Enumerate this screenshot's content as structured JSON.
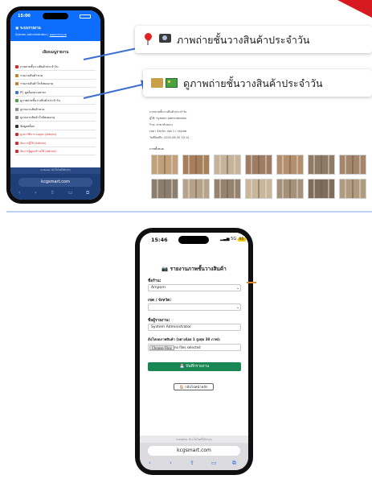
{
  "phone1": {
    "time": "15:00",
    "brand": "ระบบรายงาน",
    "user_prefix": "System Administrator |",
    "logout": "ออกจากระบบ",
    "menu_title": "เลือกเมนูรายงาน",
    "menu_items": [
      {
        "label": "ภาพถ่ายชั้นวางสินค้าประจำวัน",
        "icon": "pin-camera-icon",
        "color": "#e02424",
        "red": false
      },
      {
        "label": "รายงานสินค้าขาด",
        "icon": "box-icon",
        "color": "#c9802e",
        "red": false
      },
      {
        "label": "รายงานสินค้าใกล้หมดอายุ",
        "icon": "box-icon",
        "color": "#c9802e",
        "red": false
      },
      {
        "label": "PC ดูสต็อกตามสาขา",
        "icon": "pc-icon",
        "color": "#3b77d6",
        "red": false
      },
      {
        "label": "ดูภาพถ่ายชั้นวางสินค้าประจำวัน",
        "icon": "folder-picture-icon",
        "color": "#48a23f",
        "red": false
      },
      {
        "label": "ดูรายงานสินค้าขาด",
        "icon": "clipboard-icon",
        "color": "#8a8a8a",
        "red": false
      },
      {
        "label": "ดูรายงานสินค้าใกล้หมดอายุ",
        "icon": "clipboard-icon",
        "color": "#8a8a8a",
        "red": false
      },
      {
        "label": "ข้อมูลสต็อก",
        "icon": "chat-icon",
        "color": "#333333",
        "red": false
      },
      {
        "label": "ดูประวัติการ Login (Admin)",
        "icon": "user-icon",
        "color": "#d72a2a",
        "red": true
      },
      {
        "label": "จัดการผู้ใช้ (Admin)",
        "icon": "user-icon",
        "color": "#d72a2a",
        "red": true
      },
      {
        "label": "จัดการผู้ดูแลร้านใช้ (Admin)",
        "icon": "user-icon",
        "color": "#d72a2a",
        "red": true
      }
    ],
    "footer": "Installer นำเว็บไซต์ได้ง่ายๆ",
    "url": "kcgsmart.com"
  },
  "callouts": {
    "take_photo": "ภาพถ่ายชั้นวางสินค้าประจำวัน",
    "view_photo": "ดูภาพถ่ายชั้นวางสินค้าประจำวัน"
  },
  "report": {
    "lines": [
      "ภาพถ่ายชั้นวางสินค้าประจำวัน",
      "ผู้ใช้: System Administrator",
      "ร้าน: สาขาตัวอย่าง",
      "เขต / จังหวัด: เขต 1 / กรุงเทพ",
      "วันที่บันทึก: 2025-06-30 10:12"
    ],
    "gallery_label": "ภาพทั้งหมด",
    "thumb_colors": [
      [
        "#c2a079",
        "#a87f5b",
        "#c6b39a",
        "#9e7d63",
        "#b48f6d",
        "#8f7a66",
        "#a4866c"
      ],
      [
        "#8c7d6f",
        "#b7a38b",
        "#95826f",
        "#c9b79c",
        "#a59079",
        "#7f6c5b",
        "#b09a80"
      ]
    ]
  },
  "phone2": {
    "time": "15:46",
    "status_right": "5G",
    "battery": "95",
    "title": "รายงานภาพชั้นวางสินค้า",
    "store_label": "ชื่อร้าน:",
    "store_value": "Amporn",
    "zone_label": "เขต / จังหวัด:",
    "zone_value": "",
    "reporter_label": "ชื่อผู้รายงาน:",
    "reporter_value": "System Administrator",
    "upload_label": "อัปโหลดภาพสินค้า (อย่างน้อย 1 สูงสุด 30 ภาพ):",
    "choose_files": "Choose Files",
    "no_file": "no files selected",
    "save_button": "บันทึกรายงาน",
    "back_button": "กลับไปหน้าหลัก",
    "footer": "Installer นำเว็บไซต์ได้ง่ายๆ",
    "url": "kcgsmart.com"
  },
  "colors": {
    "primary": "#0d6efd",
    "success": "#198754",
    "danger": "#d72a2a",
    "accent_red": "#d71920"
  }
}
